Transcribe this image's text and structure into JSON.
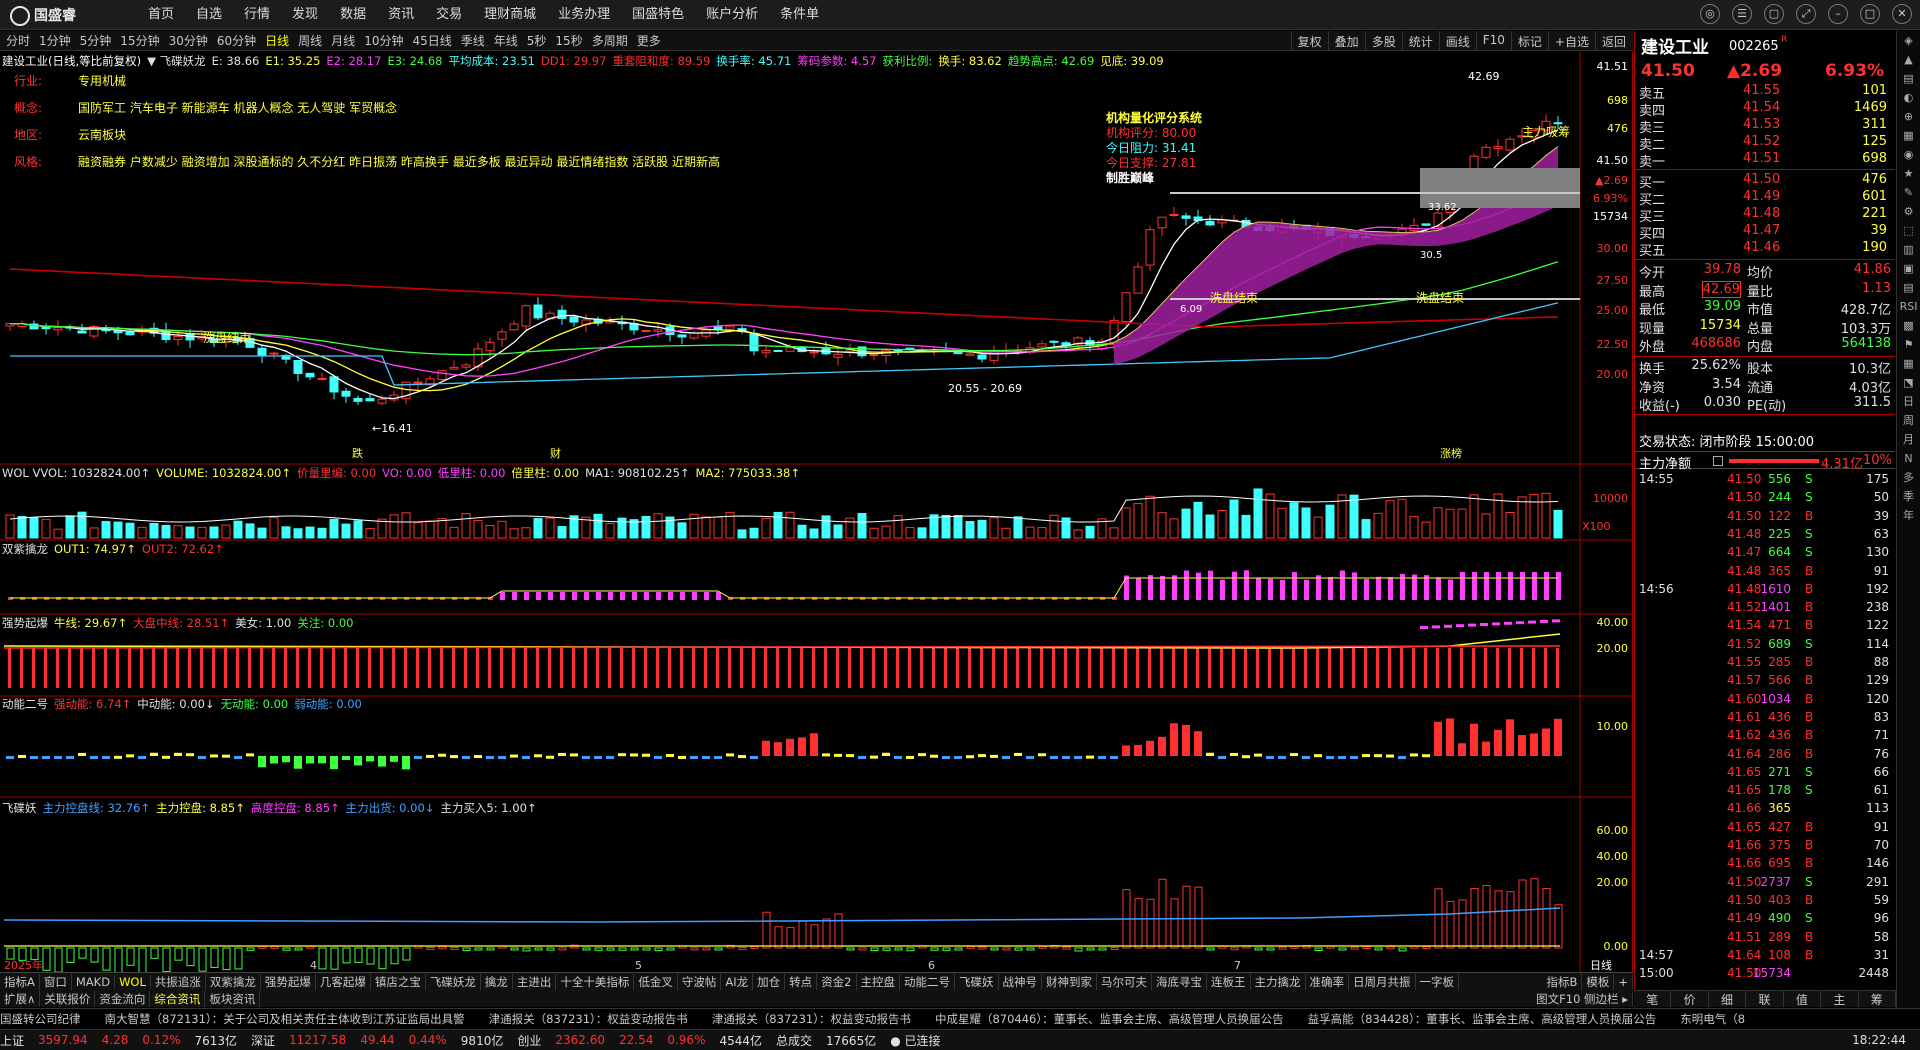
{
  "app": {
    "logo_text": "国盛睿",
    "menu": [
      "首页",
      "自选",
      "行情",
      "发现",
      "数据",
      "资讯",
      "交易",
      "理财商城",
      "业务办理",
      "国盛特色",
      "账户分析",
      "条件单"
    ]
  },
  "periods": [
    "分时",
    "1分钟",
    "5分钟",
    "15分钟",
    "30分钟",
    "60分钟",
    "日线",
    "周线",
    "月线",
    "10分钟",
    "45日线",
    "季线",
    "年线",
    "5秒",
    "15秒",
    "多周期",
    "更多"
  ],
  "active_period": "日线",
  "toolbar_right": [
    "复权",
    "叠加",
    "多股",
    "统计",
    "画线",
    "F10",
    "标记",
    "+自选",
    "返回"
  ],
  "info_line": {
    "title": "建设工业(日线,等比前复权)",
    "items": [
      {
        "t": "▼ 飞碟妖龙",
        "c": "#e0e0e0"
      },
      {
        "t": "E: 38.66",
        "c": "#e0e0e0"
      },
      {
        "t": "E1: 35.25",
        "c": "#ffff40"
      },
      {
        "t": "E2: 28.17",
        "c": "#ff40ff"
      },
      {
        "t": "E3: 24.68",
        "c": "#40ff40"
      },
      {
        "t": "平均成本: 23.51",
        "c": "#40ffff"
      },
      {
        "t": "DD1: 29.97",
        "c": "#ff3030"
      },
      {
        "t": "重套阻和度: 89.59",
        "c": "#ff3030"
      },
      {
        "t": "换手率: 45.71",
        "c": "#40ffff"
      },
      {
        "t": "筹码参数: 4.57",
        "c": "#ff40ff"
      },
      {
        "t": "获利比例:",
        "c": "#40ff40"
      },
      {
        "t": "换手: 83.62",
        "c": "#ffff40"
      },
      {
        "t": "趋势高点: 42.69",
        "c": "#40ff40"
      },
      {
        "t": "见底: 39.09",
        "c": "#ffff40"
      }
    ]
  },
  "props": [
    {
      "k": "行业:",
      "v": "专用机械"
    },
    {
      "k": "概念:",
      "v": "国防军工 汽车电子 新能源车 机器人概念 无人驾驶 军贸概念"
    },
    {
      "k": "地区:",
      "v": "云南板块"
    },
    {
      "k": "风格:",
      "v": "融资融券 户数减少 融资增加 深股通标的 久不分红 昨日振荡 昨高换手 最近多板 最近异动 最近情绪指数 活跃股 近期新高"
    }
  ],
  "quant": {
    "title": "机构量化评分系统",
    "l1": "机构评分: 80.00",
    "l2": "今日阻力: 31.41",
    "l3": "今日支撑: 27.81",
    "l4": "制胜巅峰"
  },
  "price_axis": {
    "ticks": [
      "41.51",
      "698",
      "476",
      "41.50",
      "▲2.69",
      "6.93%",
      "15734",
      "30.00",
      "27.50",
      "25.00",
      "22.50",
      "20.00"
    ]
  },
  "chart_labels": {
    "hi": "42.69",
    "lo": "16.41",
    "range": "20.55 - 20.69",
    "main_force": "主力吸筹",
    "wash1": "洗盘结束",
    "wash2": "洗盘结束",
    "wash3": "洗盘结束",
    "box_val": "33.62",
    "c2": "30.5",
    "d1": "6.09",
    "m1": "跌",
    "m2": "财",
    "m3": "涨榜",
    "x100": "X100"
  },
  "panels": {
    "vol": {
      "items": [
        {
          "t": "WOL VVOL: 1032824.00↑",
          "c": "#e0e0e0"
        },
        {
          "t": "VOLUME: 1032824.00↑",
          "c": "#ffff40"
        },
        {
          "t": "价量里编: 0.00",
          "c": "#ff3030"
        },
        {
          "t": "VO: 0.00",
          "c": "#ff40ff"
        },
        {
          "t": "低里柱: 0.00",
          "c": "#ff40ff"
        },
        {
          "t": "倍里柱: 0.00",
          "c": "#ffff40"
        },
        {
          "t": "MA1: 908102.25↑",
          "c": "#e0e0e0"
        },
        {
          "t": "MA2: 775033.38↑",
          "c": "#ffff40"
        }
      ],
      "axis": [
        "10000"
      ]
    },
    "dragon": {
      "items": [
        {
          "t": "双紫擒龙",
          "c": "#e0e0e0"
        },
        {
          "t": "OUT1: 74.97↑",
          "c": "#ffff40"
        },
        {
          "t": "OUT2: 72.62↑",
          "c": "#ff3030"
        }
      ]
    },
    "strong": {
      "items": [
        {
          "t": "强势起爆",
          "c": "#e0e0e0"
        },
        {
          "t": "牛线: 29.67↑",
          "c": "#ffff40"
        },
        {
          "t": "大盘中线: 28.51↑",
          "c": "#ff3030"
        },
        {
          "t": "美女: 1.00",
          "c": "#e0e0e0"
        },
        {
          "t": "关注: 0.00",
          "c": "#40ff40"
        }
      ],
      "axis": [
        "40.00",
        "20.00"
      ]
    },
    "energy": {
      "items": [
        {
          "t": "动能二号",
          "c": "#e0e0e0"
        },
        {
          "t": "强动能: 6.74↑",
          "c": "#ff3030"
        },
        {
          "t": "中动能: 0.00↓",
          "c": "#e0e0e0"
        },
        {
          "t": "无动能: 0.00",
          "c": "#40ff40"
        },
        {
          "t": "弱动能: 0.00",
          "c": "#40a0ff"
        }
      ],
      "axis": [
        "10.00"
      ]
    },
    "ufo": {
      "items": [
        {
          "t": "飞碟妖",
          "c": "#e0e0e0"
        },
        {
          "t": "主力控盘线: 32.76↑",
          "c": "#40a0ff"
        },
        {
          "t": "主力控盘: 8.85↑",
          "c": "#ffff40"
        },
        {
          "t": "高度控盘: 8.85↑",
          "c": "#ff40ff"
        },
        {
          "t": "主力出货: 0.00↓",
          "c": "#40a0ff"
        },
        {
          "t": "主力买入5: 1.00↑",
          "c": "#e0e0e0"
        }
      ],
      "axis": [
        "60.00",
        "40.00",
        "20.00",
        "0.00"
      ]
    }
  },
  "date_axis": [
    "2025年",
    "4",
    "5",
    "6",
    "7"
  ],
  "date_right": "日线",
  "bottom_tabs": [
    "指标A",
    "窗口",
    "MAKD",
    "WOL",
    "共振追涨",
    "双紫擒龙",
    "强势起爆",
    "几客起爆",
    "镇店之宝",
    "飞碟妖龙",
    "擒龙",
    "主进出",
    "十全十美指标",
    "低金叉",
    "守波帖",
    "AI龙",
    "加仓",
    "转点",
    "资金2",
    "主控盘",
    "动能二号",
    "飞碟妖",
    "战神号",
    "财神到家",
    "马尔可夫",
    "海底寻宝",
    "连板王",
    "主力擒龙",
    "准确率",
    "日周月共振",
    "一字板"
  ],
  "bottom_tabs_right": [
    "指标B",
    "模板",
    "+"
  ],
  "active_bottom_tab": "WOL",
  "bottom2": [
    {
      "t": "扩展∧",
      "c": "#c8c8c8"
    },
    {
      "t": "关联报价",
      "c": "#c8c8c8"
    },
    {
      "t": "资金流向",
      "c": "#c8c8c8"
    },
    {
      "t": "综合资讯",
      "c": "#ffff40"
    },
    {
      "t": "板块资讯",
      "c": "#c8c8c8"
    }
  ],
  "bottom2_right": "图文F10  侧边栏 ▸",
  "news": [
    "国盛转公司纪律",
    "南大智慧（872131）：关于公司及相关责任主体收到江苏证监局出具警",
    "津通报关（837231）：权益变动报告书",
    "津通报关（837231）：权益变动报告书",
    "中成星耀（870446）：董事长、监事会主席、高级管理人员换届公告",
    "益孚高能（834428）：董事长、监事会主席、高级管理人员换届公告",
    "东明电气（8"
  ],
  "status": [
    {
      "t": "上证",
      "c": "#e0e0e0"
    },
    {
      "t": "3597.94",
      "c": "#ff3030"
    },
    {
      "t": "4.28",
      "c": "#ff3030"
    },
    {
      "t": "0.12%",
      "c": "#ff3030"
    },
    {
      "t": "7613亿",
      "c": "#e0e0e0"
    },
    {
      "t": "深证",
      "c": "#e0e0e0"
    },
    {
      "t": "11217.58",
      "c": "#ff3030"
    },
    {
      "t": "49.44",
      "c": "#ff3030"
    },
    {
      "t": "0.44%",
      "c": "#ff3030"
    },
    {
      "t": "9810亿",
      "c": "#e0e0e0"
    },
    {
      "t": "创业",
      "c": "#e0e0e0"
    },
    {
      "t": "2362.60",
      "c": "#ff3030"
    },
    {
      "t": "22.54",
      "c": "#ff3030"
    },
    {
      "t": "0.96%",
      "c": "#ff3030"
    },
    {
      "t": "4544亿",
      "c": "#e0e0e0"
    },
    {
      "t": "总成交",
      "c": "#e0e0e0"
    },
    {
      "t": "17665亿",
      "c": "#e0e0e0"
    },
    {
      "t": "● 已连接",
      "c": "#e0e0e0"
    }
  ],
  "clock": "18:22:44",
  "quote": {
    "name": "建设工业",
    "code": "002265",
    "tag": "R",
    "price": "41.50",
    "change": "▲2.69",
    "pct": "6.93%",
    "asks": [
      {
        "l": "卖五",
        "p": "41.55",
        "v": "101"
      },
      {
        "l": "卖四",
        "p": "41.54",
        "v": "1469"
      },
      {
        "l": "卖三",
        "p": "41.53",
        "v": "311"
      },
      {
        "l": "卖二",
        "p": "41.52",
        "v": "125"
      },
      {
        "l": "卖一",
        "p": "41.51",
        "v": "698"
      }
    ],
    "bids": [
      {
        "l": "买一",
        "p": "41.50",
        "v": "476"
      },
      {
        "l": "买二",
        "p": "41.49",
        "v": "601"
      },
      {
        "l": "买三",
        "p": "41.48",
        "v": "221"
      },
      {
        "l": "买四",
        "p": "41.47",
        "v": "39"
      },
      {
        "l": "买五",
        "p": "41.46",
        "v": "190"
      }
    ],
    "stats": [
      {
        "k1": "今开",
        "v1": "39.78",
        "c1": "#ff3030",
        "k2": "均价",
        "v2": "41.86",
        "c2": "#ff3030"
      },
      {
        "k1": "最高",
        "v1": "42.69",
        "c1": "#ff3030",
        "k2": "量比",
        "v2": "1.13",
        "c2": "#ff3030"
      },
      {
        "k1": "最低",
        "v1": "39.09",
        "c1": "#40ff40",
        "k2": "市值",
        "v2": "428.7亿",
        "c2": "#e0e0e0"
      },
      {
        "k1": "现量",
        "v1": "15734",
        "c1": "#ffff40",
        "k2": "总量",
        "v2": "103.3万",
        "c2": "#e0e0e0"
      },
      {
        "k1": "外盘",
        "v1": "468686",
        "c1": "#ff3030",
        "k2": "内盘",
        "v2": "564138",
        "c2": "#40ff40"
      }
    ],
    "stats2": [
      {
        "k1": "换手",
        "v1": "25.62%",
        "k2": "股本",
        "v2": "10.3亿"
      },
      {
        "k1": "净资",
        "v1": "3.54",
        "k2": "流通",
        "v2": "4.03亿"
      },
      {
        "k1": "收益(-)",
        "v1": "0.030",
        "k2": "PE(动)",
        "v2": "311.5"
      }
    ],
    "trade_status": "交易状态: 闭市阶段 15:00:00",
    "net_label": "主力净额",
    "net_value": "4.31亿",
    "net_pct": "10%",
    "ticks": [
      {
        "t": "14:55",
        "p": "41.50",
        "v": "556",
        "s": "S",
        "n": "175"
      },
      {
        "t": "",
        "p": "41.50",
        "v": "244",
        "s": "S",
        "n": "50"
      },
      {
        "t": "",
        "p": "41.50",
        "v": "122",
        "s": "B",
        "n": "39"
      },
      {
        "t": "",
        "p": "41.48",
        "v": "225",
        "s": "S",
        "n": "63"
      },
      {
        "t": "",
        "p": "41.47",
        "v": "664",
        "s": "S",
        "n": "130"
      },
      {
        "t": "",
        "p": "41.48",
        "v": "365",
        "s": "B",
        "n": "91"
      },
      {
        "t": "14:56",
        "p": "41.48",
        "v": "1610",
        "s": "B",
        "n": "192"
      },
      {
        "t": "",
        "p": "41.52",
        "v": "1401",
        "s": "B",
        "n": "238"
      },
      {
        "t": "",
        "p": "41.54",
        "v": "471",
        "s": "B",
        "n": "122"
      },
      {
        "t": "",
        "p": "41.52",
        "v": "689",
        "s": "S",
        "n": "114"
      },
      {
        "t": "",
        "p": "41.55",
        "v": "285",
        "s": "B",
        "n": "88"
      },
      {
        "t": "",
        "p": "41.57",
        "v": "566",
        "s": "B",
        "n": "129"
      },
      {
        "t": "",
        "p": "41.60",
        "v": "1034",
        "s": "B",
        "n": "120"
      },
      {
        "t": "",
        "p": "41.61",
        "v": "436",
        "s": "B",
        "n": "83"
      },
      {
        "t": "",
        "p": "41.62",
        "v": "436",
        "s": "B",
        "n": "71"
      },
      {
        "t": "",
        "p": "41.64",
        "v": "286",
        "s": "B",
        "n": "76"
      },
      {
        "t": "",
        "p": "41.65",
        "v": "271",
        "s": "S",
        "n": "66"
      },
      {
        "t": "",
        "p": "41.65",
        "v": "178",
        "s": "S",
        "n": "61"
      },
      {
        "t": "",
        "p": "41.66",
        "v": "365",
        "s": "",
        "n": "113"
      },
      {
        "t": "",
        "p": "41.65",
        "v": "427",
        "s": "B",
        "n": "91"
      },
      {
        "t": "",
        "p": "41.66",
        "v": "375",
        "s": "B",
        "n": "70"
      },
      {
        "t": "",
        "p": "41.66",
        "v": "695",
        "s": "B",
        "n": "146"
      },
      {
        "t": "",
        "p": "41.50",
        "v": "2737",
        "s": "S",
        "n": "291"
      },
      {
        "t": "",
        "p": "41.50",
        "v": "403",
        "s": "B",
        "n": "59"
      },
      {
        "t": "",
        "p": "41.49",
        "v": "490",
        "s": "S",
        "n": "96"
      },
      {
        "t": "",
        "p": "41.51",
        "v": "289",
        "s": "B",
        "n": "58"
      },
      {
        "t": "14:57",
        "p": "41.64",
        "v": "108",
        "s": "B",
        "n": "31"
      },
      {
        "t": "15:00",
        "p": "41.50",
        "v": "15734",
        "s": "",
        "n": "2448"
      }
    ]
  },
  "right_tabs": [
    "笔",
    "价",
    "细",
    "联",
    "值",
    "主",
    "筹"
  ],
  "right_sidebar": [
    "◈",
    "▲",
    "▤",
    "◐",
    "⊕",
    "▦",
    "◉",
    "★",
    "✎",
    "⚙",
    "⬚",
    "▥",
    "▣",
    "▤",
    "RSI",
    "▩",
    "⚑",
    "▦",
    "⬔",
    "日",
    "周",
    "月",
    "N",
    "多",
    "季",
    "年"
  ]
}
